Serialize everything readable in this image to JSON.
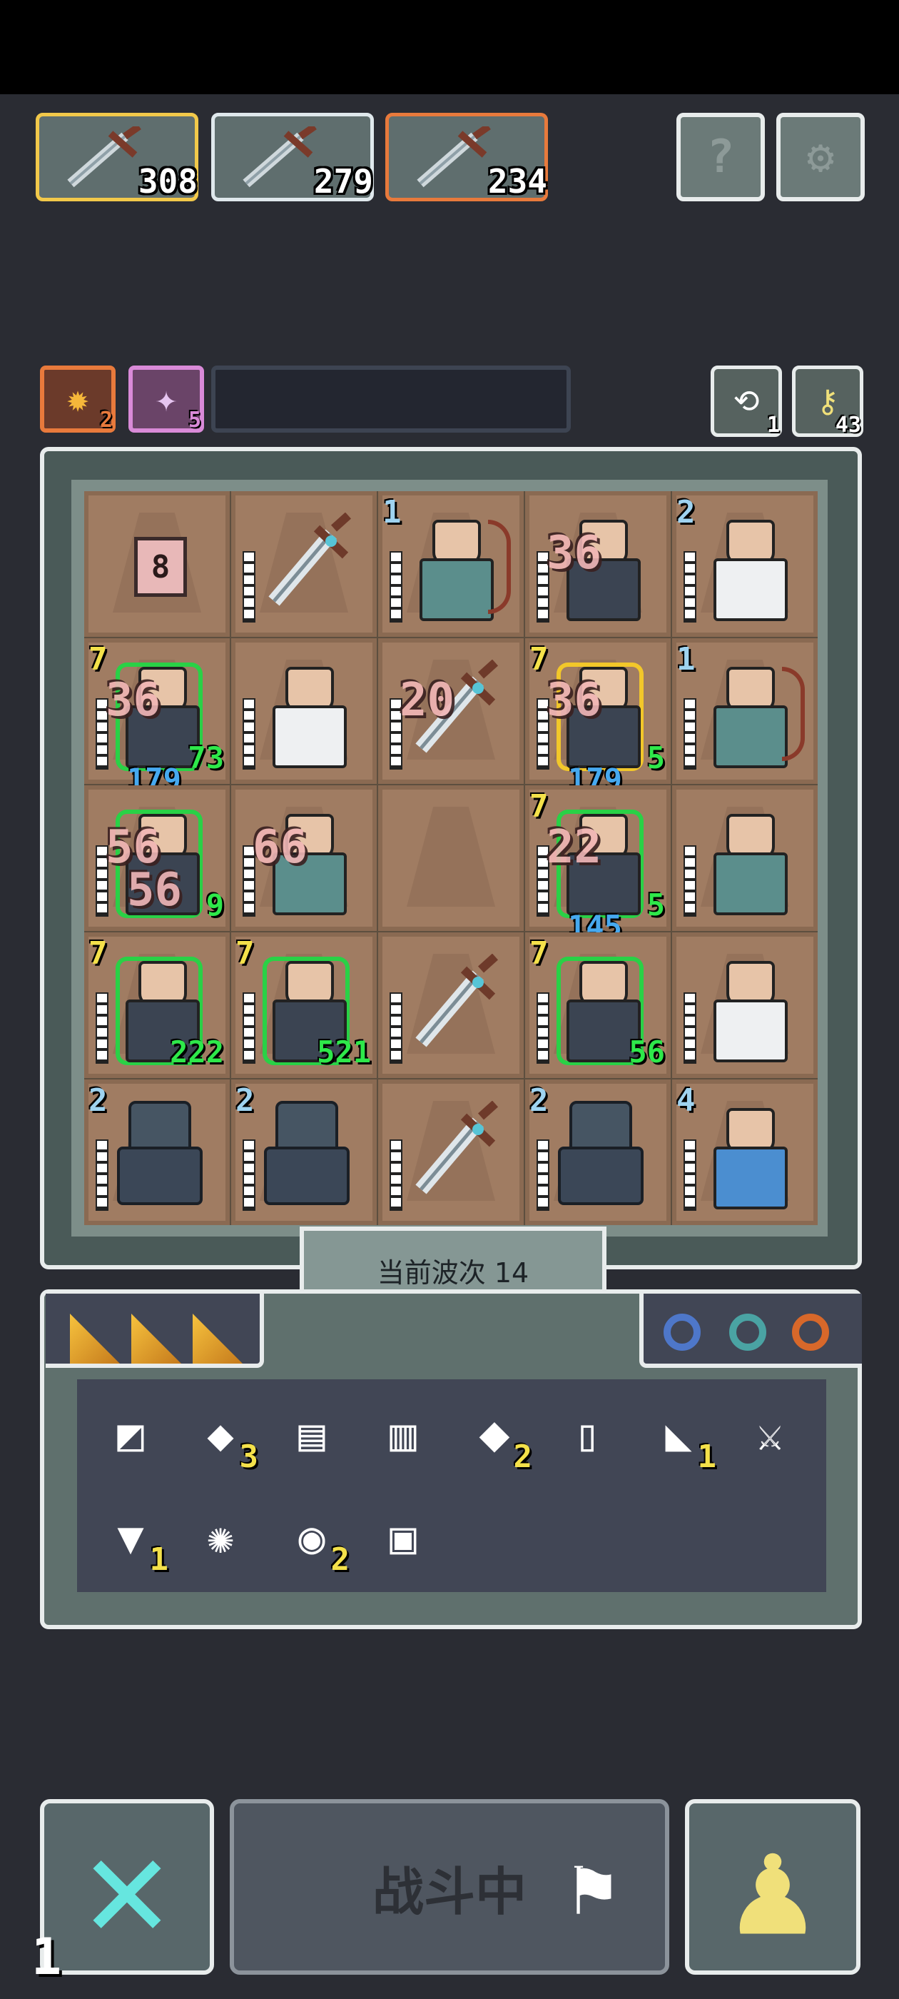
{
  "weapons": [
    {
      "icon": "sword-icon",
      "value": "308",
      "border": "#f2c94a"
    },
    {
      "icon": "sword-icon",
      "value": "279",
      "border": "#dfe8ec"
    },
    {
      "icon": "sword-icon",
      "value": "234",
      "border": "#e87a3c"
    }
  ],
  "top_buttons": {
    "help": "?",
    "settings": "⚙"
  },
  "buffs": [
    {
      "icon": "sunflower-icon",
      "count": "2",
      "color": "#e87a3c"
    },
    {
      "icon": "star-icon",
      "count": "5",
      "color": "#d98ad8"
    }
  ],
  "side_buttons": [
    {
      "icon": "refresh-icon",
      "count": "1"
    },
    {
      "icon": "key-icon",
      "count": "43"
    }
  ],
  "board": {
    "cells": [
      {
        "type": "sign",
        "value": "8"
      },
      {
        "type": "sword"
      },
      {
        "type": "unit",
        "level": "1",
        "color": "teal",
        "archer": true
      },
      {
        "type": "unit",
        "color": "dark",
        "dmg": "36"
      },
      {
        "type": "unit",
        "level": "2",
        "color": "white"
      },
      {
        "type": "unit",
        "level": "7",
        "color": "dark",
        "glow": "green",
        "dmg": "36",
        "stat_g": "73",
        "stat_b": "179"
      },
      {
        "type": "unit",
        "color": "white"
      },
      {
        "type": "sword",
        "dmg": "20"
      },
      {
        "type": "unit",
        "level": "7",
        "color": "dark",
        "glow": "yellow",
        "dmg": "36",
        "stat_g": "5",
        "stat_b": "179"
      },
      {
        "type": "unit",
        "level": "1",
        "color": "teal",
        "archer": true
      },
      {
        "type": "unit",
        "color": "dark",
        "glow": "green",
        "dmg": "56",
        "dmg2": "56",
        "stat_g": "9"
      },
      {
        "type": "unit",
        "color": "teal",
        "dmg": "66"
      },
      {
        "type": "empty"
      },
      {
        "type": "unit",
        "level": "7",
        "color": "dark",
        "glow": "green",
        "dmg": "22",
        "stat_g": "5",
        "stat_b": "145"
      },
      {
        "type": "unit",
        "color": "teal"
      },
      {
        "type": "unit",
        "level": "7",
        "color": "dark",
        "glow": "green",
        "stat_g": "222"
      },
      {
        "type": "unit",
        "level": "7",
        "color": "dark",
        "glow": "green",
        "stat_g": "521"
      },
      {
        "type": "sword"
      },
      {
        "type": "unit",
        "level": "7",
        "color": "dark",
        "glow": "green",
        "stat_g": "56"
      },
      {
        "type": "unit",
        "color": "white"
      },
      {
        "type": "monster",
        "level": "2"
      },
      {
        "type": "monster",
        "level": "2"
      },
      {
        "type": "sword"
      },
      {
        "type": "monster",
        "level": "2"
      },
      {
        "type": "unit",
        "level": "4",
        "color": "blue"
      }
    ]
  },
  "wave_label": "当前波次 14",
  "inventory": {
    "triangles": [
      "gold-shard-icon",
      "gold-shard-icon",
      "gold-shard-icon"
    ],
    "rings": [
      {
        "icon": "ring-icon",
        "color": "#4e77c9"
      },
      {
        "icon": "ring-icon",
        "color": "#4aa3a3"
      },
      {
        "icon": "ring-icon",
        "color": "#d8682a"
      }
    ],
    "items": [
      {
        "icon": "banner-icon",
        "glyph": "◩",
        "qty": ""
      },
      {
        "icon": "emerald-icon",
        "glyph": "◆",
        "qty": "3"
      },
      {
        "icon": "scroll-box-icon",
        "glyph": "▤",
        "qty": ""
      },
      {
        "icon": "cauldron-icon",
        "glyph": "▥",
        "qty": ""
      },
      {
        "icon": "crystal-icon",
        "glyph": "⬥",
        "qty": "2"
      },
      {
        "icon": "paper-icon",
        "glyph": "▯",
        "qty": ""
      },
      {
        "icon": "boot-icon",
        "glyph": "◣",
        "qty": "1"
      },
      {
        "icon": "sword-icon",
        "glyph": "⚔",
        "qty": ""
      },
      {
        "icon": "anvil-icon",
        "glyph": "▼",
        "qty": "1"
      },
      {
        "icon": "wheel-icon",
        "glyph": "✺",
        "qty": ""
      },
      {
        "icon": "shell-icon",
        "glyph": "◉",
        "qty": "2"
      },
      {
        "icon": "mirror-icon",
        "glyph": "▣",
        "qty": ""
      }
    ]
  },
  "bottom": {
    "cancel_icon": "✕",
    "battle_label": "战斗中",
    "speed": "1"
  }
}
